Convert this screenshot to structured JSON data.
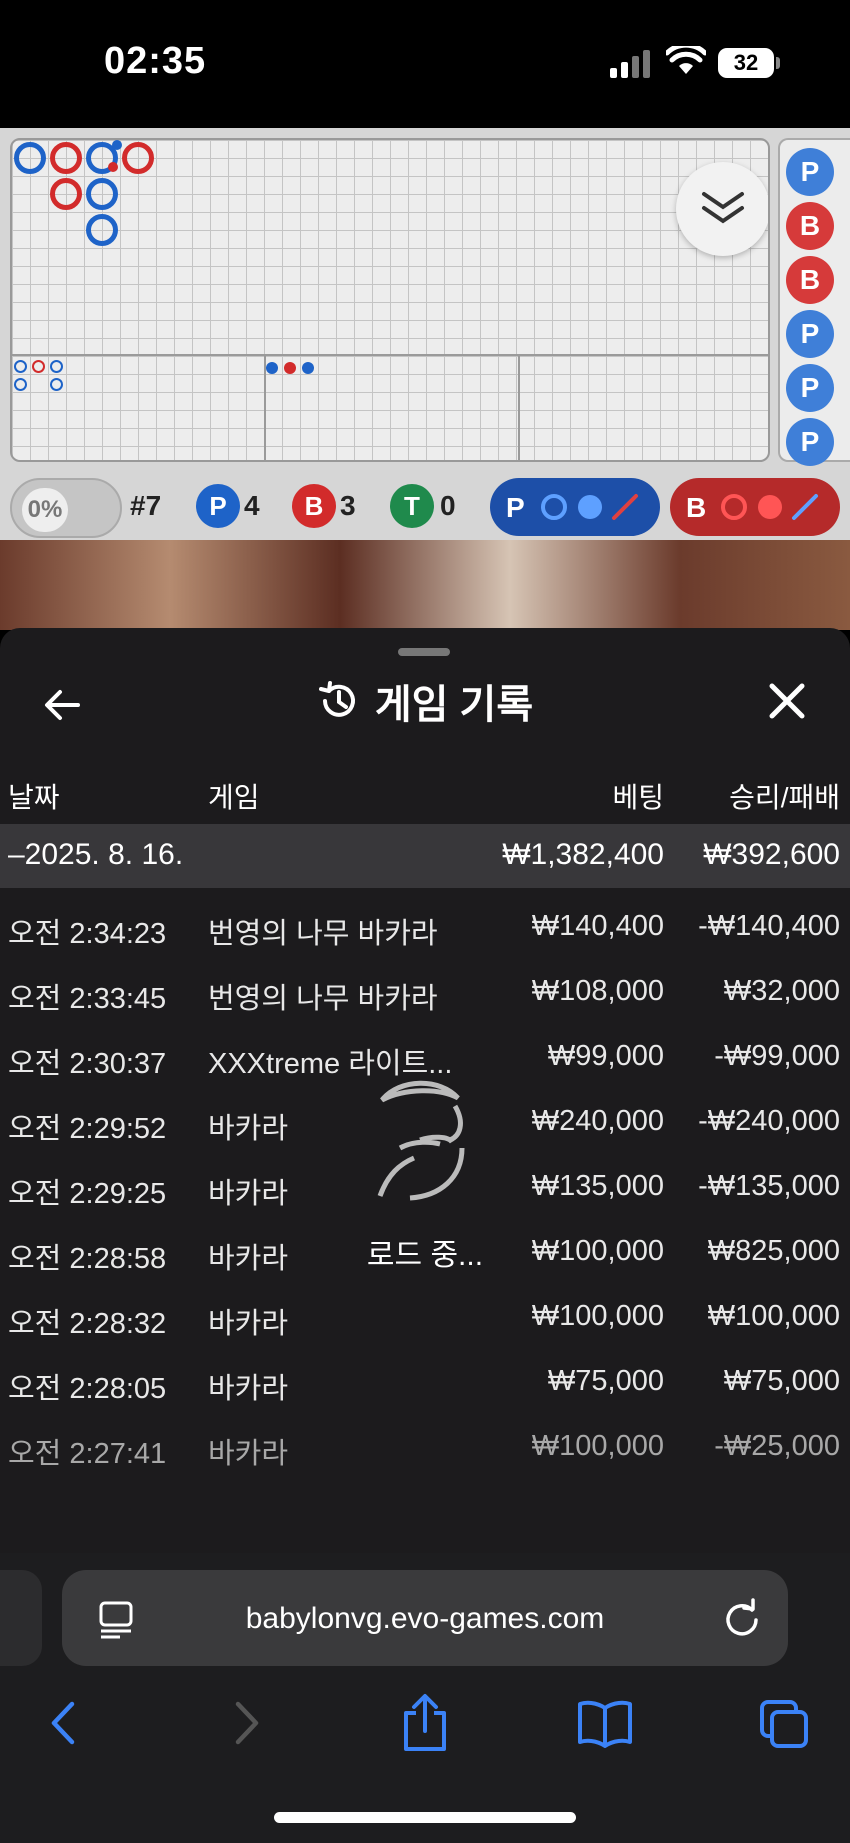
{
  "status_bar": {
    "time": "02:35",
    "battery": "32"
  },
  "game": {
    "shoe_label": "#7",
    "percent": "0%",
    "counts": [
      {
        "letter": "P",
        "value": "4",
        "color": "#1e63c8"
      },
      {
        "letter": "B",
        "value": "3",
        "color": "#d22b2b"
      },
      {
        "letter": "T",
        "value": "0",
        "color": "#1f8a4c"
      }
    ],
    "predict_player": "P",
    "predict_banker": "B",
    "side_results": [
      "P",
      "B",
      "B",
      "P",
      "P",
      "P"
    ]
  },
  "history": {
    "title": "게임 기록",
    "columns": {
      "date": "날짜",
      "game": "게임",
      "bet": "베팅",
      "winloss": "승리/패배"
    },
    "summary": {
      "date": "–2025. 8. 16.",
      "bet": "₩1,382,400",
      "winloss": "₩392,600"
    },
    "rows": [
      {
        "time": "오전 2:34:23",
        "game": "번영의 나무 바카라",
        "bet": "₩140,400",
        "winloss": "-₩140,400"
      },
      {
        "time": "오전 2:33:45",
        "game": "번영의 나무 바카라",
        "bet": "₩108,000",
        "winloss": "₩32,000"
      },
      {
        "time": "오전 2:30:37",
        "game": "XXXtreme 라이트...",
        "bet": "₩99,000",
        "winloss": "-₩99,000"
      },
      {
        "time": "오전 2:29:52",
        "game": "바카라",
        "bet": "₩240,000",
        "winloss": "-₩240,000"
      },
      {
        "time": "오전 2:29:25",
        "game": "바카라",
        "bet": "₩135,000",
        "winloss": "-₩135,000"
      },
      {
        "time": "오전 2:28:58",
        "game": "바카라",
        "bet": "₩100,000",
        "winloss": "₩825,000"
      },
      {
        "time": "오전 2:28:32",
        "game": "바카라",
        "bet": "₩100,000",
        "winloss": "₩100,000"
      },
      {
        "time": "오전 2:28:05",
        "game": "바카라",
        "bet": "₩75,000",
        "winloss": "₩75,000"
      },
      {
        "time": "오전 2:27:41",
        "game": "바카라",
        "bet": "₩100,000",
        "winloss": "-₩25,000"
      }
    ],
    "loading_text": "로드 중..."
  },
  "browser": {
    "url": "babylonvg.evo-games.com"
  }
}
